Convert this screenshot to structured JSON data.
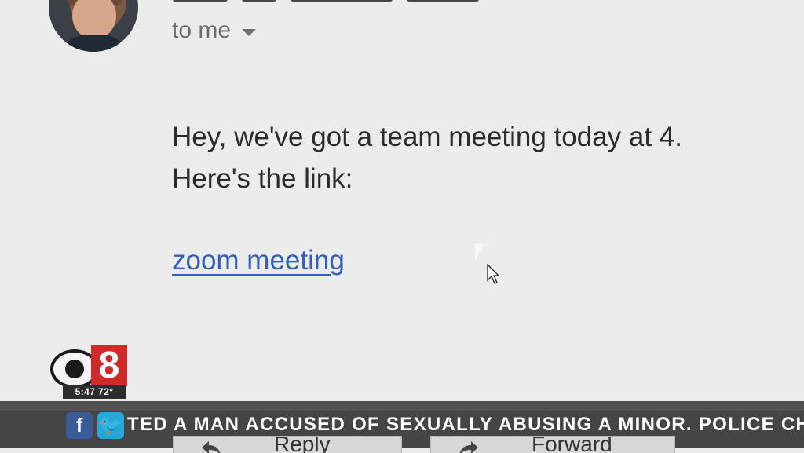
{
  "email": {
    "recipient_label": "to me",
    "body_lines": [
      "Hey, we've got a team meeting today at 4.",
      "Here's the link:"
    ],
    "link_text": "zoom meeting"
  },
  "overlay": {
    "station_number": "8",
    "time_temp": "5:47 72°",
    "ticker_text": "TED A MAN ACCUSED OF SEXUALLY ABUSING A MINOR. POLICE CHARG",
    "social_icons": [
      "facebook-icon",
      "twitter-icon"
    ]
  },
  "actions": {
    "reply_label": "Reply",
    "forward_label": "Forward"
  },
  "colors": {
    "background": "#ececec",
    "link": "#3660b7",
    "ticker": "#454545",
    "logo_red": "#cf2a2a",
    "facebook": "#3b5b98",
    "twitter": "#25a7d8"
  }
}
